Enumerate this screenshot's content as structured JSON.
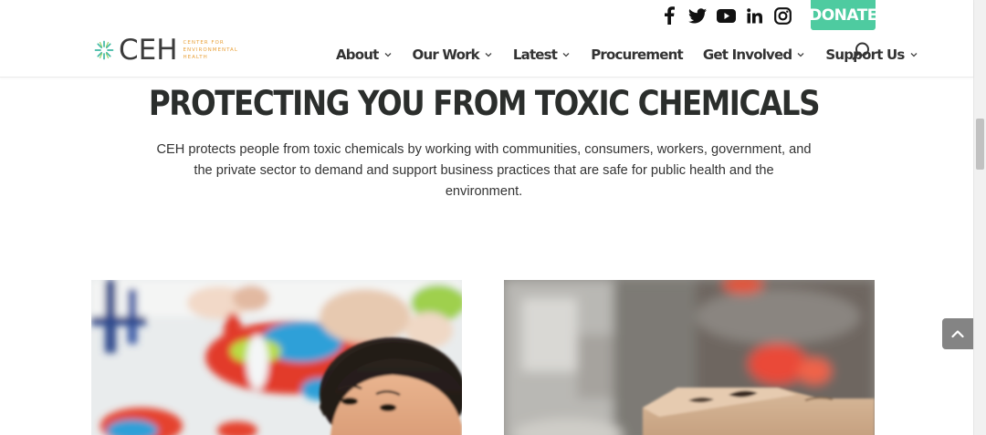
{
  "header": {
    "logo": {
      "mark": "CEH",
      "tagline_lines": [
        "CENTER for",
        "ENVIRONMENTAL",
        "HEALTH"
      ]
    },
    "social_icons": [
      "facebook-icon",
      "twitter-icon",
      "youtube-icon",
      "linkedin-icon",
      "instagram-icon"
    ],
    "donate_label": "DONATE",
    "nav": [
      {
        "label": "About",
        "has_dropdown": true
      },
      {
        "label": "Our Work",
        "has_dropdown": true
      },
      {
        "label": "Latest",
        "has_dropdown": true
      },
      {
        "label": "Procurement",
        "has_dropdown": false
      },
      {
        "label": "Get Involved",
        "has_dropdown": true
      },
      {
        "label": "Support Us",
        "has_dropdown": true
      }
    ],
    "search_icon": "search-icon"
  },
  "hero": {
    "headline": "PROTECTING YOU FROM TOXIC CHEMICALS",
    "intro_lines": [
      "CEH protects people from toxic chemicals by working with communities, consumers, workers, government, and",
      "the private sector to demand and support business practices that are safe for public health and the",
      "environment."
    ]
  },
  "colors": {
    "accent_green": "#4ecba0",
    "logo_orange": "#e9a13a",
    "logo_teal": "#3fb8a4",
    "text_dark": "#2b2e2c"
  },
  "controls": {
    "back_to_top_icon": "chevron-up-icon"
  }
}
